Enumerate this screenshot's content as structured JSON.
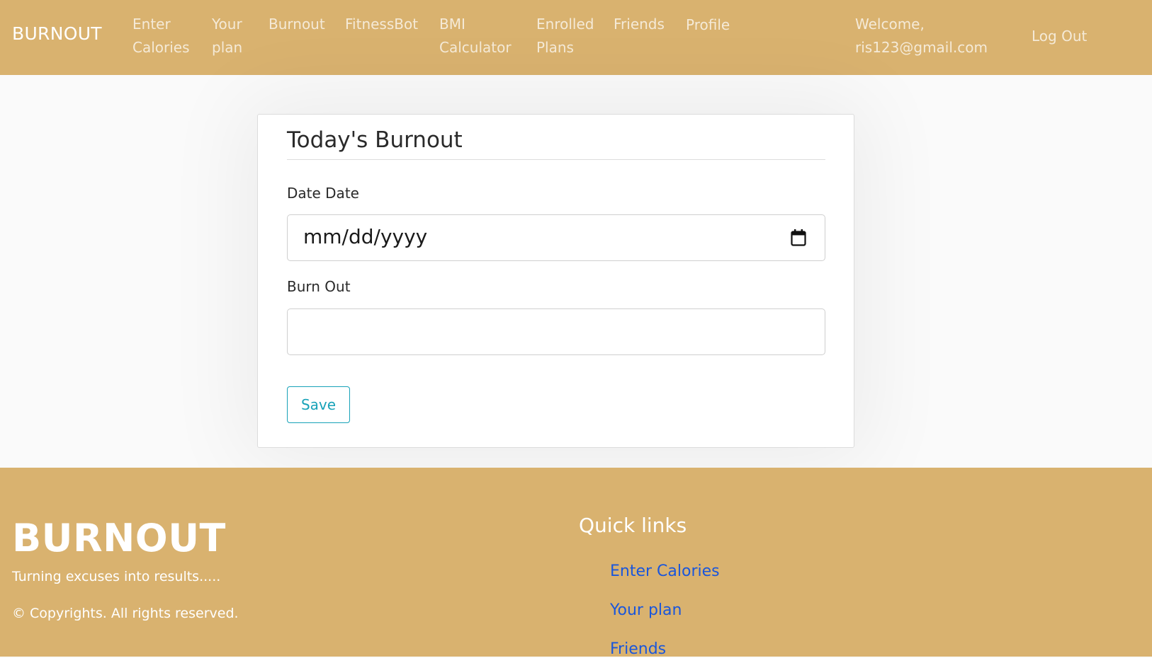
{
  "navbar": {
    "brand": "BURNOUT",
    "links": [
      {
        "line1": "Enter",
        "line2": "Calories"
      },
      {
        "line1": "Your",
        "line2": "plan"
      },
      {
        "line1": "Burnout"
      },
      {
        "line1": "FitnessBot"
      },
      {
        "line1": "BMI",
        "line2": "Calculator"
      },
      {
        "line1": "Enrolled",
        "line2": "Plans"
      },
      {
        "line1": "Friends"
      },
      {
        "line1": "Profile"
      }
    ],
    "welcome_line1": "Welcome,",
    "welcome_line2": "ris123@gmail.com",
    "logout": "Log Out"
  },
  "form": {
    "title": "Today's Burnout",
    "date_label": "Date Date",
    "date_placeholder": "mm/dd/yyyy",
    "burnout_label": "Burn Out",
    "burnout_value": "",
    "save_label": "Save"
  },
  "footer": {
    "brand": "BURNOUT",
    "tagline": "Turning excuses into results.....",
    "copyright": "© Copyrights. All rights reserved.",
    "quick_links_title": "Quick links",
    "quick_links": [
      "Enter Calories",
      "Your plan",
      "Friends"
    ]
  },
  "colors": {
    "nav_bg": "#d9b26f",
    "accent_button": "#17a2b8",
    "link": "#1a56db"
  }
}
